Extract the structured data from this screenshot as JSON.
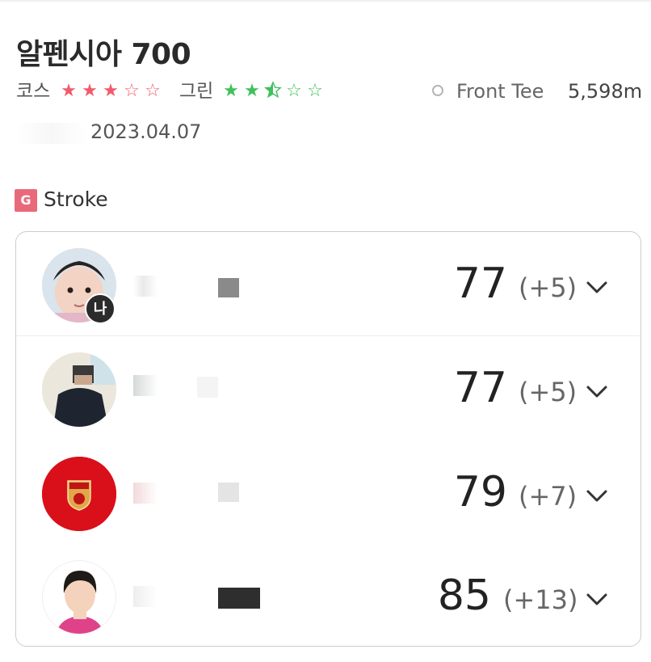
{
  "course": {
    "title": "알펜시아 700",
    "course_label": "코스",
    "course_rating": 3,
    "course_stars": "★★★☆☆",
    "green_label": "그린",
    "green_rating": 2.5,
    "green_stars": "★★⯪☆☆",
    "tee": "Front Tee",
    "distance": "5,598m",
    "date": "2023.04.07"
  },
  "section": {
    "badge": "G",
    "label": "Stroke"
  },
  "players": [
    {
      "is_me": true,
      "me_badge": "나",
      "score": "77",
      "diff": "(+5)"
    },
    {
      "is_me": false,
      "score": "77",
      "diff": "(+5)"
    },
    {
      "is_me": false,
      "score": "79",
      "diff": "(+7)"
    },
    {
      "is_me": false,
      "score": "85",
      "diff": "(+13)"
    }
  ],
  "colors": {
    "course_star": "#f25a6c",
    "green_star": "#3fc15a",
    "badge": "#e86a7a",
    "border": "#c8cdd3"
  }
}
